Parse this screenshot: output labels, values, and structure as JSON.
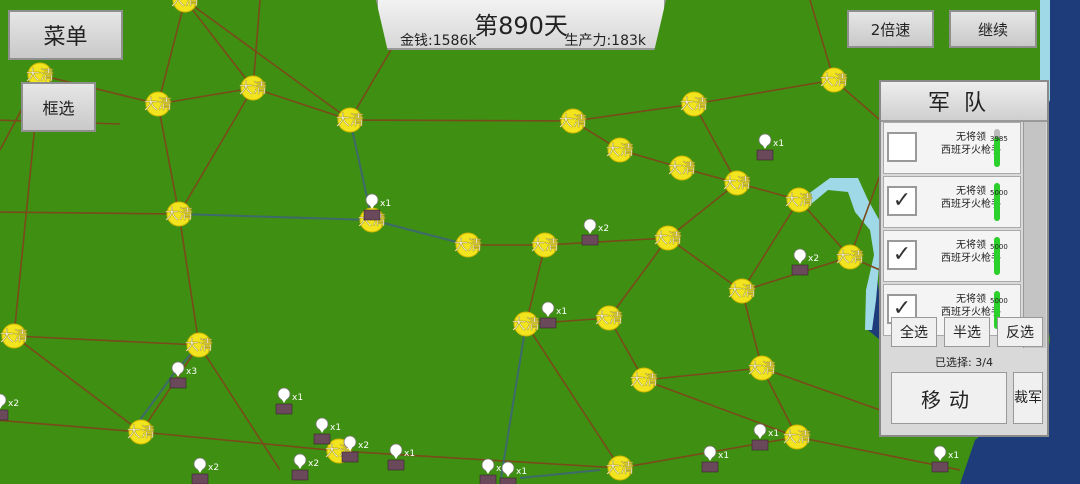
{
  "hud": {
    "day": "第890天",
    "money": "金钱:1586k",
    "production": "生产力:183k"
  },
  "buttons": {
    "menu": "菜单",
    "box_select": "框选",
    "speed": "2倍速",
    "continue": "继续"
  },
  "map": {
    "city_label": "大清",
    "ground_color": "#3f8f12",
    "road_color": "#7a4a1a",
    "water_color": "#1e3c7a",
    "shallow_color": "#9fd8e6"
  },
  "army_panel": {
    "title": "军队",
    "units": [
      {
        "leader": "无将领",
        "type": "西班牙火枪手",
        "hp": 3985,
        "hp_fraction": 0.8,
        "checked": false
      },
      {
        "leader": "无将领",
        "type": "西班牙火枪手",
        "hp": 5000,
        "hp_fraction": 1.0,
        "checked": true
      },
      {
        "leader": "无将领",
        "type": "西班牙火枪手",
        "hp": 5000,
        "hp_fraction": 1.0,
        "checked": true
      },
      {
        "leader": "无将领",
        "type": "西班牙火枪手",
        "hp": 5000,
        "hp_fraction": 1.0,
        "checked": true
      }
    ],
    "select_all": "全选",
    "select_half": "半选",
    "invert": "反选",
    "selected": "已选择: 3/4",
    "move": "移动",
    "disband": "裁军"
  },
  "army_counts": [
    "x1",
    "x2",
    "x3"
  ]
}
